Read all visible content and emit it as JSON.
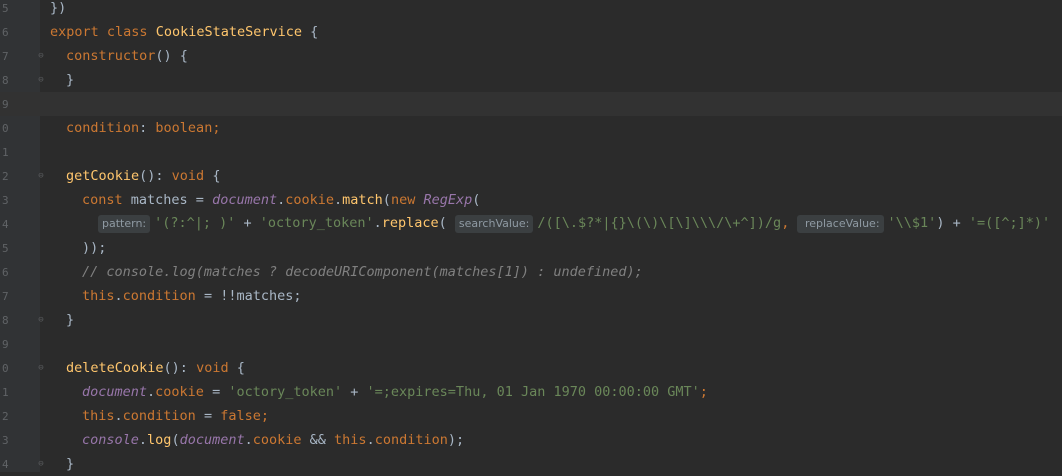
{
  "editor": {
    "lines": [
      {
        "num": "5",
        "indent": 0,
        "tokens": [
          {
            "t": "})",
            "c": "plain"
          }
        ],
        "fold": ""
      },
      {
        "num": "6",
        "indent": 0,
        "tokens": [
          {
            "t": "export ",
            "c": "kw"
          },
          {
            "t": "class ",
            "c": "kw"
          },
          {
            "t": "CookieStateService",
            "c": "cls"
          },
          {
            "t": " {",
            "c": "plain"
          }
        ],
        "fold": ""
      },
      {
        "num": "7",
        "indent": 1,
        "tokens": [
          {
            "t": "constructor",
            "c": "kw"
          },
          {
            "t": "() {",
            "c": "plain"
          }
        ],
        "fold": "⊖"
      },
      {
        "num": "8",
        "indent": 1,
        "tokens": [
          {
            "t": "}",
            "c": "plain"
          }
        ],
        "fold": "⊖"
      },
      {
        "num": "9",
        "indent": 0,
        "tokens": [],
        "fold": "",
        "current": true
      },
      {
        "num": "0",
        "indent": 1,
        "tokens": [
          {
            "t": "condition",
            "c": "field"
          },
          {
            "t": ": ",
            "c": "plain"
          },
          {
            "t": "boolean",
            "c": "kw"
          },
          {
            "t": ";",
            "c": "orng"
          }
        ],
        "fold": ""
      },
      {
        "num": "1",
        "indent": 0,
        "tokens": [],
        "fold": ""
      },
      {
        "num": "2",
        "indent": 1,
        "tokens": [
          {
            "t": "getCookie",
            "c": "fn"
          },
          {
            "t": "(): ",
            "c": "plain"
          },
          {
            "t": "void",
            "c": "kw"
          },
          {
            "t": " {",
            "c": "plain"
          }
        ],
        "fold": "⊖"
      },
      {
        "num": "3",
        "indent": 2,
        "tokens": [
          {
            "t": "const ",
            "c": "kw"
          },
          {
            "t": "matches = ",
            "c": "plain"
          },
          {
            "t": "document",
            "c": "glob"
          },
          {
            "t": ".",
            "c": "plain"
          },
          {
            "t": "cookie",
            "c": "field"
          },
          {
            "t": ".",
            "c": "plain"
          },
          {
            "t": "match",
            "c": "fn"
          },
          {
            "t": "(",
            "c": "plain"
          },
          {
            "t": "new ",
            "c": "kw"
          },
          {
            "t": "RegExp",
            "c": "glob"
          },
          {
            "t": "(",
            "c": "plain"
          }
        ],
        "fold": ""
      },
      {
        "num": "4",
        "indent": 3,
        "tokens": [
          {
            "t": "pattern:",
            "c": "hint"
          },
          {
            "t": "'(?:^|; )'",
            "c": "str"
          },
          {
            "t": " + ",
            "c": "plain"
          },
          {
            "t": "'octory_token'",
            "c": "str"
          },
          {
            "t": ".",
            "c": "plain"
          },
          {
            "t": "replace",
            "c": "fn"
          },
          {
            "t": "( ",
            "c": "plain"
          },
          {
            "t": "searchValue:",
            "c": "hint"
          },
          {
            "t": "/([\\.$?*|{}\\(\\)\\[\\]\\\\\\/\\+^])/g",
            "c": "re"
          },
          {
            "t": ", ",
            "c": "orng"
          },
          {
            "t": " replaceValue:",
            "c": "hint"
          },
          {
            "t": "'\\\\$1'",
            "c": "str"
          },
          {
            "t": ") + ",
            "c": "plain"
          },
          {
            "t": "'=([^;]*)'",
            "c": "str"
          }
        ],
        "fold": ""
      },
      {
        "num": "5",
        "indent": 2,
        "tokens": [
          {
            "t": "));",
            "c": "plain"
          }
        ],
        "fold": ""
      },
      {
        "num": "6",
        "indent": 2,
        "tokens": [
          {
            "t": "// console.log(matches ? decodeURIComponent(matches[1]) : undefined);",
            "c": "cmt"
          }
        ],
        "fold": ""
      },
      {
        "num": "7",
        "indent": 2,
        "tokens": [
          {
            "t": "this",
            "c": "kw"
          },
          {
            "t": ".",
            "c": "plain"
          },
          {
            "t": "condition",
            "c": "field"
          },
          {
            "t": " = !!matches;",
            "c": "plain"
          }
        ],
        "fold": ""
      },
      {
        "num": "8",
        "indent": 1,
        "tokens": [
          {
            "t": "}",
            "c": "plain"
          }
        ],
        "fold": "⊖"
      },
      {
        "num": "9",
        "indent": 0,
        "tokens": [],
        "fold": ""
      },
      {
        "num": "0",
        "indent": 1,
        "tokens": [
          {
            "t": "deleteCookie",
            "c": "fn"
          },
          {
            "t": "(): ",
            "c": "plain"
          },
          {
            "t": "void",
            "c": "kw"
          },
          {
            "t": " {",
            "c": "plain"
          }
        ],
        "fold": "⊖"
      },
      {
        "num": "1",
        "indent": 2,
        "tokens": [
          {
            "t": "document",
            "c": "glob"
          },
          {
            "t": ".",
            "c": "plain"
          },
          {
            "t": "cookie",
            "c": "field"
          },
          {
            "t": " = ",
            "c": "plain"
          },
          {
            "t": "'octory_token'",
            "c": "str"
          },
          {
            "t": " + ",
            "c": "plain"
          },
          {
            "t": "'=;expires=Thu, 01 Jan 1970 00:00:00 GMT'",
            "c": "str"
          },
          {
            "t": ";",
            "c": "orng"
          }
        ],
        "fold": ""
      },
      {
        "num": "2",
        "indent": 2,
        "tokens": [
          {
            "t": "this",
            "c": "kw"
          },
          {
            "t": ".",
            "c": "plain"
          },
          {
            "t": "condition",
            "c": "field"
          },
          {
            "t": " = ",
            "c": "plain"
          },
          {
            "t": "false",
            "c": "kw"
          },
          {
            "t": ";",
            "c": "orng"
          }
        ],
        "fold": ""
      },
      {
        "num": "3",
        "indent": 2,
        "tokens": [
          {
            "t": "console",
            "c": "glob"
          },
          {
            "t": ".",
            "c": "plain"
          },
          {
            "t": "log",
            "c": "fn"
          },
          {
            "t": "(",
            "c": "plain"
          },
          {
            "t": "document",
            "c": "glob"
          },
          {
            "t": ".",
            "c": "plain"
          },
          {
            "t": "cookie",
            "c": "field"
          },
          {
            "t": " && ",
            "c": "plain"
          },
          {
            "t": "this",
            "c": "kw"
          },
          {
            "t": ".",
            "c": "plain"
          },
          {
            "t": "condition",
            "c": "field"
          },
          {
            "t": ");",
            "c": "plain"
          }
        ],
        "fold": ""
      },
      {
        "num": "4",
        "indent": 1,
        "tokens": [
          {
            "t": "}",
            "c": "plain"
          }
        ],
        "fold": "⊖"
      }
    ]
  },
  "colors": {
    "background": "#2b2b2b",
    "gutter": "#313335",
    "keyword": "#cc7832",
    "string": "#6a8759",
    "function": "#ffc66d",
    "comment": "#808080",
    "global": "#9876aa",
    "plain": "#a9b7c6"
  }
}
